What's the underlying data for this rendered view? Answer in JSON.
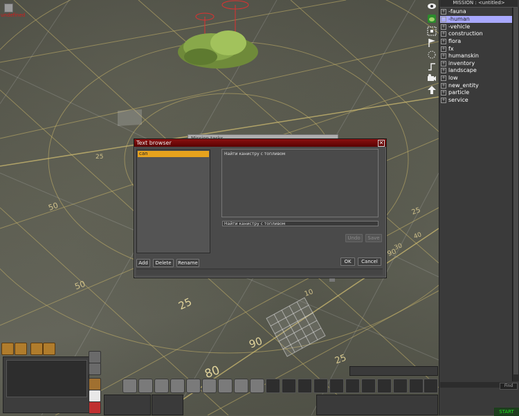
{
  "viewport": {
    "status_label": "undefined",
    "grid_labels": [
      "25",
      "50",
      "25",
      "90",
      "80",
      "50",
      "25",
      "90",
      "10",
      "25",
      "20",
      "30",
      "40",
      "90"
    ]
  },
  "mission_panel": {
    "title": "MISSION : <untitled>",
    "tree_items": [
      {
        "label": "-fauna",
        "expander": "+",
        "selected": false
      },
      {
        "label": "-human",
        "expander": "+",
        "selected": true
      },
      {
        "label": "-vehicle",
        "expander": "+",
        "selected": false
      },
      {
        "label": "construction",
        "expander": "+",
        "selected": false
      },
      {
        "label": "flora",
        "expander": "+",
        "selected": false
      },
      {
        "label": "fx",
        "expander": "+",
        "selected": false
      },
      {
        "label": "humanskin",
        "expander": "+",
        "selected": false
      },
      {
        "label": "inventory",
        "expander": "+",
        "selected": false
      },
      {
        "label": "landscape",
        "expander": "+",
        "selected": false
      },
      {
        "label": "low",
        "expander": "+",
        "selected": false
      },
      {
        "label": "new_entity",
        "expander": "+",
        "selected": false
      },
      {
        "label": "particle",
        "expander": "+",
        "selected": false
      },
      {
        "label": "service",
        "expander": "+",
        "selected": false
      }
    ],
    "find_label": "Find",
    "start_label": "START"
  },
  "tool_icons": [
    "eye-icon",
    "grenade-icon",
    "selection-grid-icon",
    "flag-icon",
    "dotted-circle-icon",
    "steps-icon",
    "camera-icon",
    "arrow-up-icon"
  ],
  "background_window": {
    "title": "Mission tasks"
  },
  "text_browser": {
    "title": "Text browser",
    "close_glyph": "✕",
    "list_items": [
      {
        "label": "can",
        "selected": true
      }
    ],
    "text_content": "Найти канистру с топливом",
    "text_line": "Найти канистру с топливом",
    "buttons": {
      "undo": "Undo",
      "save": "Save",
      "add": "Add",
      "delete": "Delete",
      "rename": "Rename",
      "ok": "OK",
      "cancel": "Cancel"
    }
  },
  "colors": {
    "dialog_title_bar": "#7a0808",
    "list_selection": "#e7a21d",
    "tree_selection": "#a9a9ff",
    "start_text": "#1fe01f",
    "undefined_text": "#d51a1a"
  },
  "hud": {
    "palette_icons": [
      "brush-icon",
      "pencil-icon",
      "compass-icon",
      "tools-icon"
    ],
    "side_icons": [
      "hand-icon",
      "arrow-icon",
      "cube-icon",
      "skull-icon",
      "fire-extinguisher-icon"
    ],
    "toolbar_icons": [
      "grenade-icon",
      "wrench-icon",
      "rifle-icon",
      "knife-icon",
      "target-icon",
      "gear-icon",
      "lamp-icon",
      "plus-icon",
      "down-arrow-icon"
    ],
    "empty_slots": 11
  }
}
